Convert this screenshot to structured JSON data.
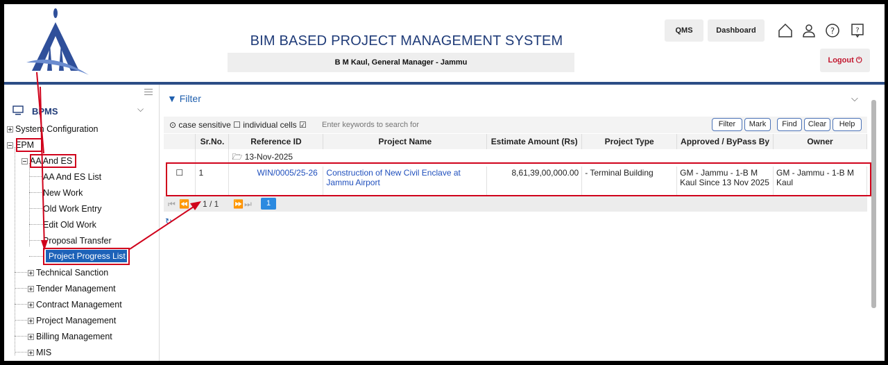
{
  "header": {
    "title": "BIM BASED PROJECT MANAGEMENT SYSTEM",
    "user": "B M Kaul, General Manager - Jammu",
    "qms": "QMS",
    "dashboard": "Dashboard",
    "logout": "Logout",
    "icons": [
      "home-icon",
      "user-icon",
      "help-icon",
      "info-icon"
    ]
  },
  "sidebar": {
    "root": "BPMS",
    "items": {
      "system_configuration": "System Configuration",
      "epm": "EPM",
      "aa_and_es": "AA And ES",
      "aa_and_es_list": "AA And ES List",
      "new_work": "New Work",
      "old_work_entry": "Old Work Entry",
      "edit_old_work": "Edit Old Work",
      "proposal_transfer": "Proposal Transfer",
      "project_progress_list": "Project Progress List",
      "technical_sanction": "Technical Sanction",
      "tender_management": "Tender Management",
      "contract_management": "Contract Management",
      "project_management": "Project Management",
      "billing_management": "Billing Management",
      "mis": "MIS"
    }
  },
  "filter": {
    "title": "Filter",
    "case_sensitive": "case sensitive",
    "individual_cells": "individual cells",
    "placeholder": "Enter keywords to search for",
    "buttons": {
      "filter": "Filter",
      "mark": "Mark",
      "find": "Find",
      "clear": "Clear",
      "help": "Help"
    }
  },
  "table": {
    "headers": {
      "sr": "Sr.No.",
      "ref": "Reference ID",
      "name": "Project Name",
      "amount": "Estimate Amount (Rs)",
      "type": "Project Type",
      "approved": "Approved / ByPass By",
      "owner": "Owner"
    },
    "group": "13-Nov-2025",
    "row": {
      "sr": "1",
      "ref": "WIN/0005/25-26",
      "name": "Construction of New Civil Enclave at Jammu Airport",
      "amount": "8,61,39,00,000.00",
      "type": "- Terminal Building",
      "approved": "GM - Jammu - 1-B M Kaul Since 13 Nov 2025",
      "owner": "GM - Jammu - 1-B M Kaul"
    }
  },
  "pager": {
    "page_info": "1 / 1",
    "current": "1"
  },
  "colors": {
    "accent": "#1f3b78",
    "highlight": "#d0021b",
    "selected": "#1d62b8"
  }
}
